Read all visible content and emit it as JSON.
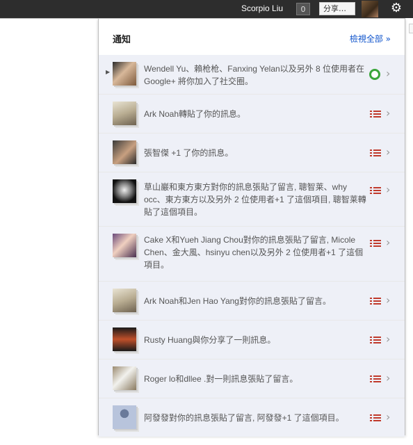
{
  "topbar": {
    "username": "Scorpio Liu",
    "count": "0",
    "share_label": "分享…",
    "gear_icon": "gear-icon"
  },
  "panel": {
    "title": "通知",
    "view_all": "檢視全部 »",
    "items": [
      {
        "text": "Wendell Yu、賴枪枪、Fanxing Yelan以及另外 8 位使用者在 Google+ 將你加入了社交圈。",
        "icon": "circle-add-icon"
      },
      {
        "text": "Ark Noah轉貼了你的訊息。",
        "icon": "stream-icon"
      },
      {
        "text": "張智傑 +1 了你的訊息。",
        "icon": "stream-icon"
      },
      {
        "text": "草山巖和東方東方對你的訊息張貼了留言, 聰智莱、why occ、東方東方以及另外 2 位使用者+1 了這個項目, 聰智莱轉貼了這個項目。",
        "icon": "stream-icon"
      },
      {
        "text": "Cake X和Yueh Jiang Chou對你的訊息張貼了留言, Micole Chen、金大風、hsinyu chen以及另外 2 位使用者+1 了這個項目。",
        "icon": "stream-icon"
      },
      {
        "text": "Ark Noah和Jen Hao Yang對你的訊息張貼了留言。",
        "icon": "stream-icon"
      },
      {
        "text": "Rusty Huang與你分享了一則訊息。",
        "icon": "stream-icon"
      },
      {
        "text": "Roger lo和dllee .對一則訊息張貼了留言。",
        "icon": "stream-icon"
      },
      {
        "text": "阿發發對你的訊息張貼了留言, 阿發發+1 了這個項目。",
        "icon": "stream-icon"
      }
    ]
  },
  "colors": {
    "topbar": "#2d2d2d",
    "link": "#1155cc",
    "item_bg": "#eef0f7",
    "stream_icon": "#c0392b",
    "circle_icon": "#3aa53a"
  }
}
